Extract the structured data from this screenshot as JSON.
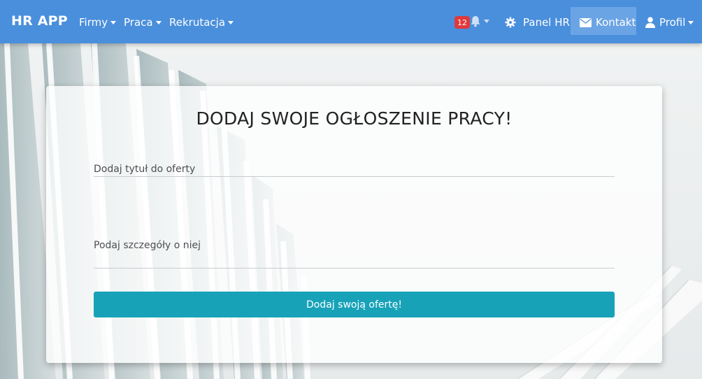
{
  "navbar": {
    "brand": "HR APP",
    "menu": [
      {
        "label": "Firmy"
      },
      {
        "label": "Praca"
      },
      {
        "label": "Rekrutacja"
      }
    ],
    "notifications_count": "12",
    "panel_hr": "Panel HR",
    "contact": "Kontakt",
    "profile": "Profil",
    "icons": {
      "bell": "bell-icon",
      "gear": "gear-icon",
      "envelope": "envelope-icon",
      "user": "user-icon"
    }
  },
  "form": {
    "title": "DODAJ SWOJE OGŁOSZENIE PRACY!",
    "job_title_placeholder": "Dodaj tytuł do oferty",
    "details_placeholder": "Podaj szczegóły o niej",
    "submit_label": "Dodaj swoją ofertę!"
  },
  "colors": {
    "navbar": "#4a8fdc",
    "active_nav": "#6ba4e5",
    "badge": "#e0393b",
    "submit": "#17a2b8"
  }
}
